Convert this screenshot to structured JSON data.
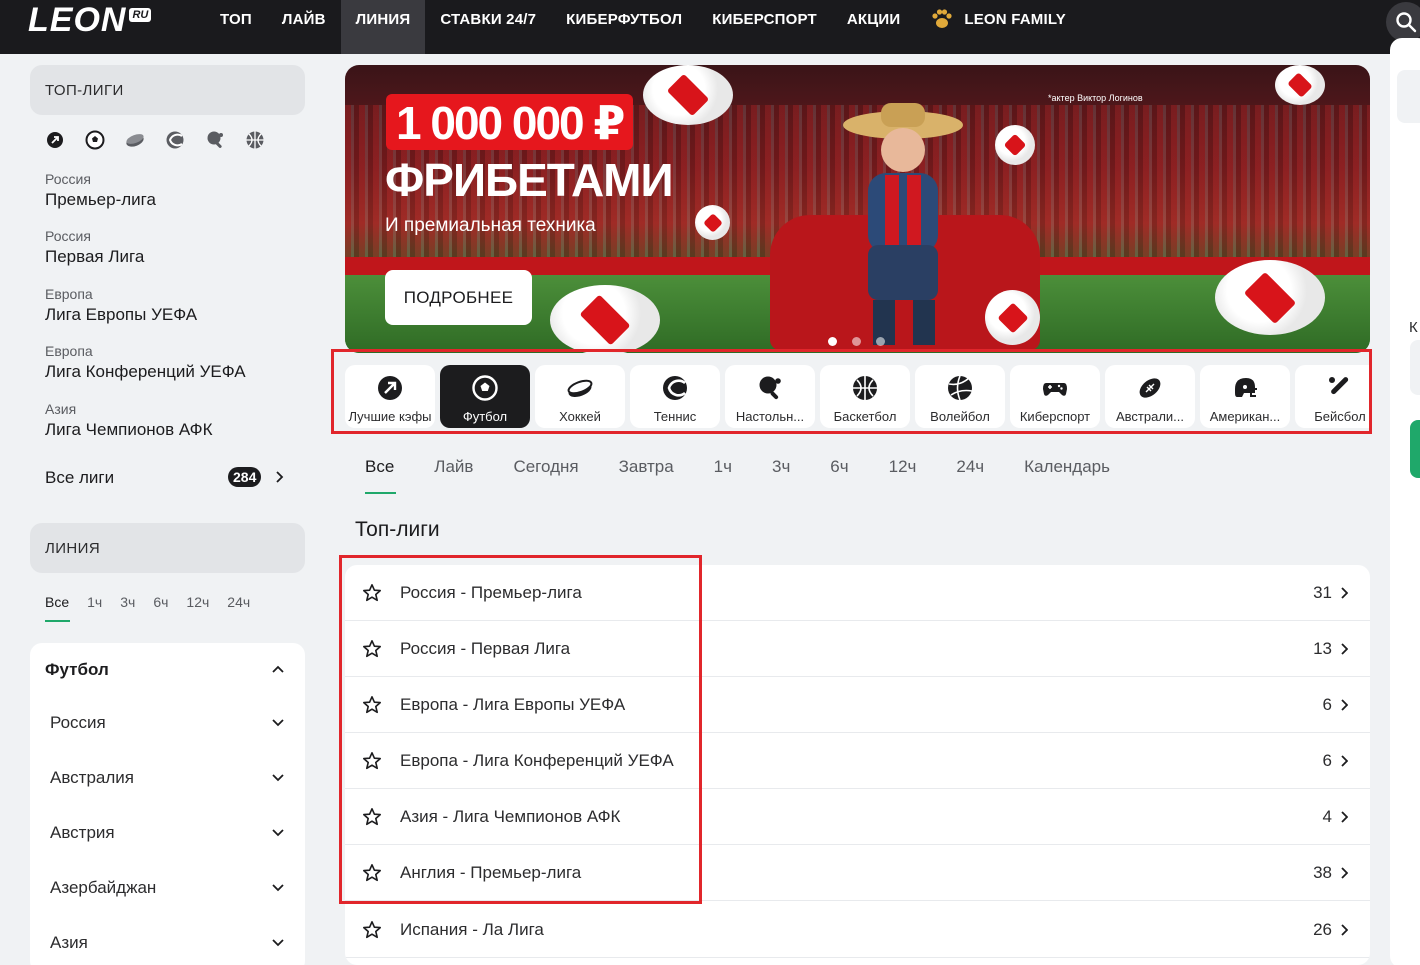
{
  "header": {
    "logo_text": "LEON",
    "logo_badge": "RU",
    "nav": [
      "ТОП",
      "ЛАЙВ",
      "ЛИНИЯ",
      "СТАВКИ 24/7",
      "КИБЕРФУТБОЛ",
      "КИБЕРСПОРТ",
      "АКЦИИ",
      "LEON FAMILY"
    ],
    "nav_active": "ЛИНИЯ"
  },
  "sidebar": {
    "top_leagues_title": "ТОП-ЛИГИ",
    "sport_icons": [
      "arrow-icon",
      "football-icon",
      "hockey-icon",
      "tennis-icon",
      "table-tennis-icon",
      "basketball-icon"
    ],
    "leagues": [
      {
        "country": "Россия",
        "name": "Премьер-лига"
      },
      {
        "country": "Россия",
        "name": "Первая Лига"
      },
      {
        "country": "Европа",
        "name": "Лига Европы УЕФА"
      },
      {
        "country": "Европа",
        "name": "Лига Конференций УЕФА"
      },
      {
        "country": "Азия",
        "name": "Лига Чемпионов АФК"
      }
    ],
    "all_leagues_label": "Все лиги",
    "all_leagues_count": "284",
    "line_title": "ЛИНИЯ",
    "time_filters": [
      "Все",
      "1ч",
      "3ч",
      "6ч",
      "12ч",
      "24ч"
    ],
    "tree_title": "Футбол",
    "tree_items": [
      "Россия",
      "Австралия",
      "Австрия",
      "Азербайджан",
      "Азия"
    ]
  },
  "banner": {
    "amount": "1 000 000 ₽",
    "title": "ФРИБЕТАМИ",
    "subtitle": "И премиальная техника",
    "button": "ПОДРОБНЕЕ",
    "note": "*актер Виктор Логинов",
    "slides": 3,
    "active_slide": 1
  },
  "sport_tabs": [
    {
      "label": "Лучшие кэфы",
      "icon": "trending-arrow-icon"
    },
    {
      "label": "Футбол",
      "icon": "football-icon"
    },
    {
      "label": "Хоккей",
      "icon": "hockey-puck-icon"
    },
    {
      "label": "Теннис",
      "icon": "tennis-icon"
    },
    {
      "label": "Настольн...",
      "icon": "table-tennis-icon"
    },
    {
      "label": "Баскетбол",
      "icon": "basketball-icon"
    },
    {
      "label": "Волейбол",
      "icon": "volleyball-icon"
    },
    {
      "label": "Киберспорт",
      "icon": "gamepad-icon"
    },
    {
      "label": "Австрали...",
      "icon": "aussie-rules-icon"
    },
    {
      "label": "Американ...",
      "icon": "american-football-helmet-icon"
    },
    {
      "label": "Бейсбол",
      "icon": "baseball-bat-icon"
    }
  ],
  "sport_tabs_active": "Футбол",
  "filter_tabs": [
    "Все",
    "Лайв",
    "Сегодня",
    "Завтра",
    "1ч",
    "3ч",
    "6ч",
    "12ч",
    "24ч",
    "Календарь"
  ],
  "section_title": "Топ-лиги",
  "league_rows": [
    {
      "name": "Россия - Премьер-лига",
      "count": "31"
    },
    {
      "name": "Россия - Первая Лига",
      "count": "13"
    },
    {
      "name": "Европа - Лига Европы УЕФА",
      "count": "6"
    },
    {
      "name": "Европа - Лига Конференций УЕФА",
      "count": "6"
    },
    {
      "name": "Азия - Лига Чемпионов АФК",
      "count": "4"
    },
    {
      "name": "Англия - Премьер-лига",
      "count": "38"
    },
    {
      "name": "Испания - Ла Лига",
      "count": "26"
    }
  ],
  "right_rail": {
    "letter": "К"
  },
  "colors": {
    "accent_green": "#1fa86a",
    "highlight_red": "#e1262b",
    "header_bg": "#1a1a1d"
  }
}
